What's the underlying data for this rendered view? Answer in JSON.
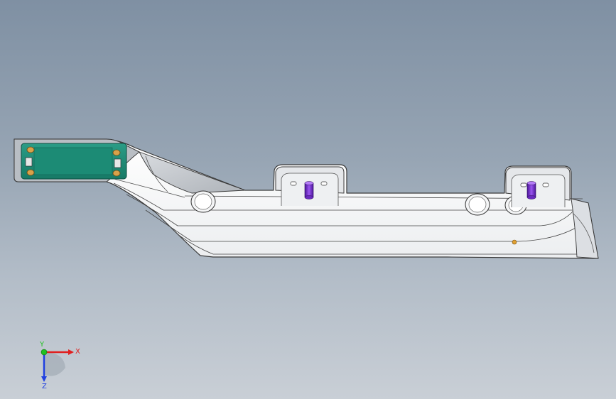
{
  "view": {
    "background_top": "#7f90a3",
    "background_bottom": "#c9cfd6"
  },
  "part": {
    "name": "bracket-part",
    "face_color": "#ffffff",
    "edge_color": "#3a3a3a",
    "mounting_pad_color": "#1f8f7a",
    "pin_color": "#7a2fd0",
    "hole_accent_color": "#d8a24a"
  },
  "triad": {
    "x_label": "X",
    "y_label": "Y",
    "z_label": "Z",
    "x_color": "#e02020",
    "y_color": "#20c020",
    "z_color": "#2040e0"
  }
}
